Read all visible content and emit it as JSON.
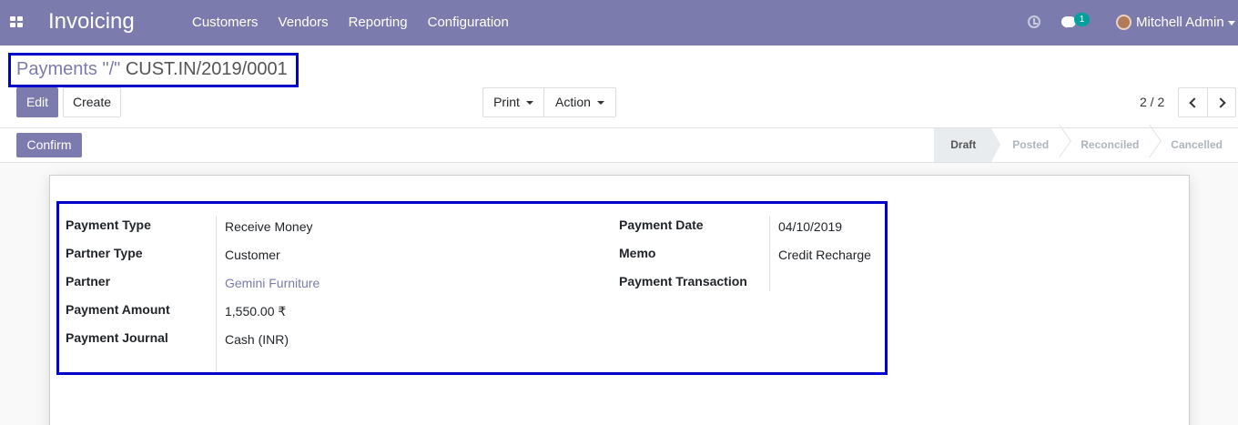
{
  "navbar": {
    "app_title": "Invoicing",
    "menu": [
      "Customers",
      "Vendors",
      "Reporting",
      "Configuration"
    ],
    "chat_badge": "1",
    "user_name": "Mitchell Admin",
    "color": "#7c7bad"
  },
  "breadcrumb": {
    "parent": "Payments",
    "separator": "\"/\"",
    "current": "CUST.IN/2019/0001"
  },
  "toolbar": {
    "edit_label": "Edit",
    "create_label": "Create",
    "print_label": "Print",
    "action_label": "Action"
  },
  "pager": {
    "value": "2 / 2"
  },
  "statusbar": {
    "confirm_label": "Confirm",
    "stages": [
      "Draft",
      "Posted",
      "Reconciled",
      "Cancelled"
    ],
    "active_stage": "Draft"
  },
  "form": {
    "payment_type_label": "Payment Type",
    "payment_type": "Receive Money",
    "partner_type_label": "Partner Type",
    "partner_type": "Customer",
    "partner_label": "Partner",
    "partner": "Gemini Furniture",
    "amount_label": "Payment Amount",
    "amount": "1,550.00 ₹",
    "journal_label": "Payment Journal",
    "journal": "Cash (INR)",
    "date_label": "Payment Date",
    "date": "04/10/2019",
    "memo_label": "Memo",
    "memo": "Credit Recharge",
    "transaction_label": "Payment Transaction",
    "transaction": ""
  }
}
